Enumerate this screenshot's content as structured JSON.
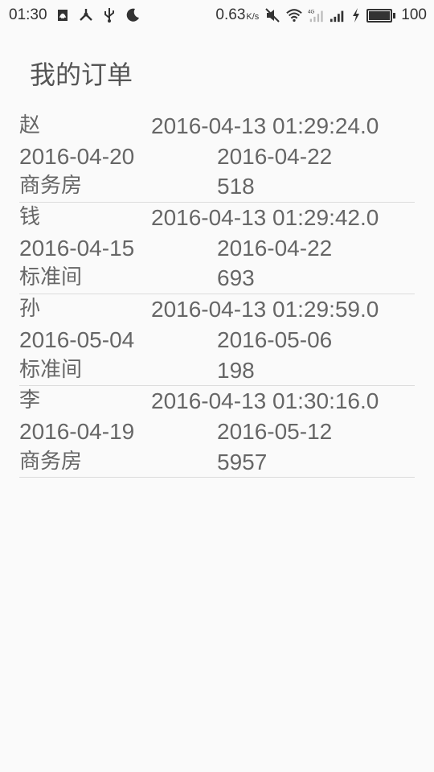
{
  "status_bar": {
    "time": "01:30",
    "speed_value": "0.63",
    "speed_unit": "K/s",
    "network": "4G",
    "battery": "100"
  },
  "page": {
    "title": "我的订单"
  },
  "orders": [
    {
      "name": "赵",
      "created": "2016-04-13 01:29:24.0",
      "check_in": "2016-04-20",
      "check_out": "2016-04-22",
      "room_type": "商务房",
      "price": "518"
    },
    {
      "name": "钱",
      "created": "2016-04-13 01:29:42.0",
      "check_in": "2016-04-15",
      "check_out": "2016-04-22",
      "room_type": "标准间",
      "price": "693"
    },
    {
      "name": "孙",
      "created": "2016-04-13 01:29:59.0",
      "check_in": "2016-05-04",
      "check_out": "2016-05-06",
      "room_type": "标准间",
      "price": "198"
    },
    {
      "name": "李",
      "created": "2016-04-13 01:30:16.0",
      "check_in": "2016-04-19",
      "check_out": "2016-05-12",
      "room_type": "商务房",
      "price": "5957"
    }
  ]
}
